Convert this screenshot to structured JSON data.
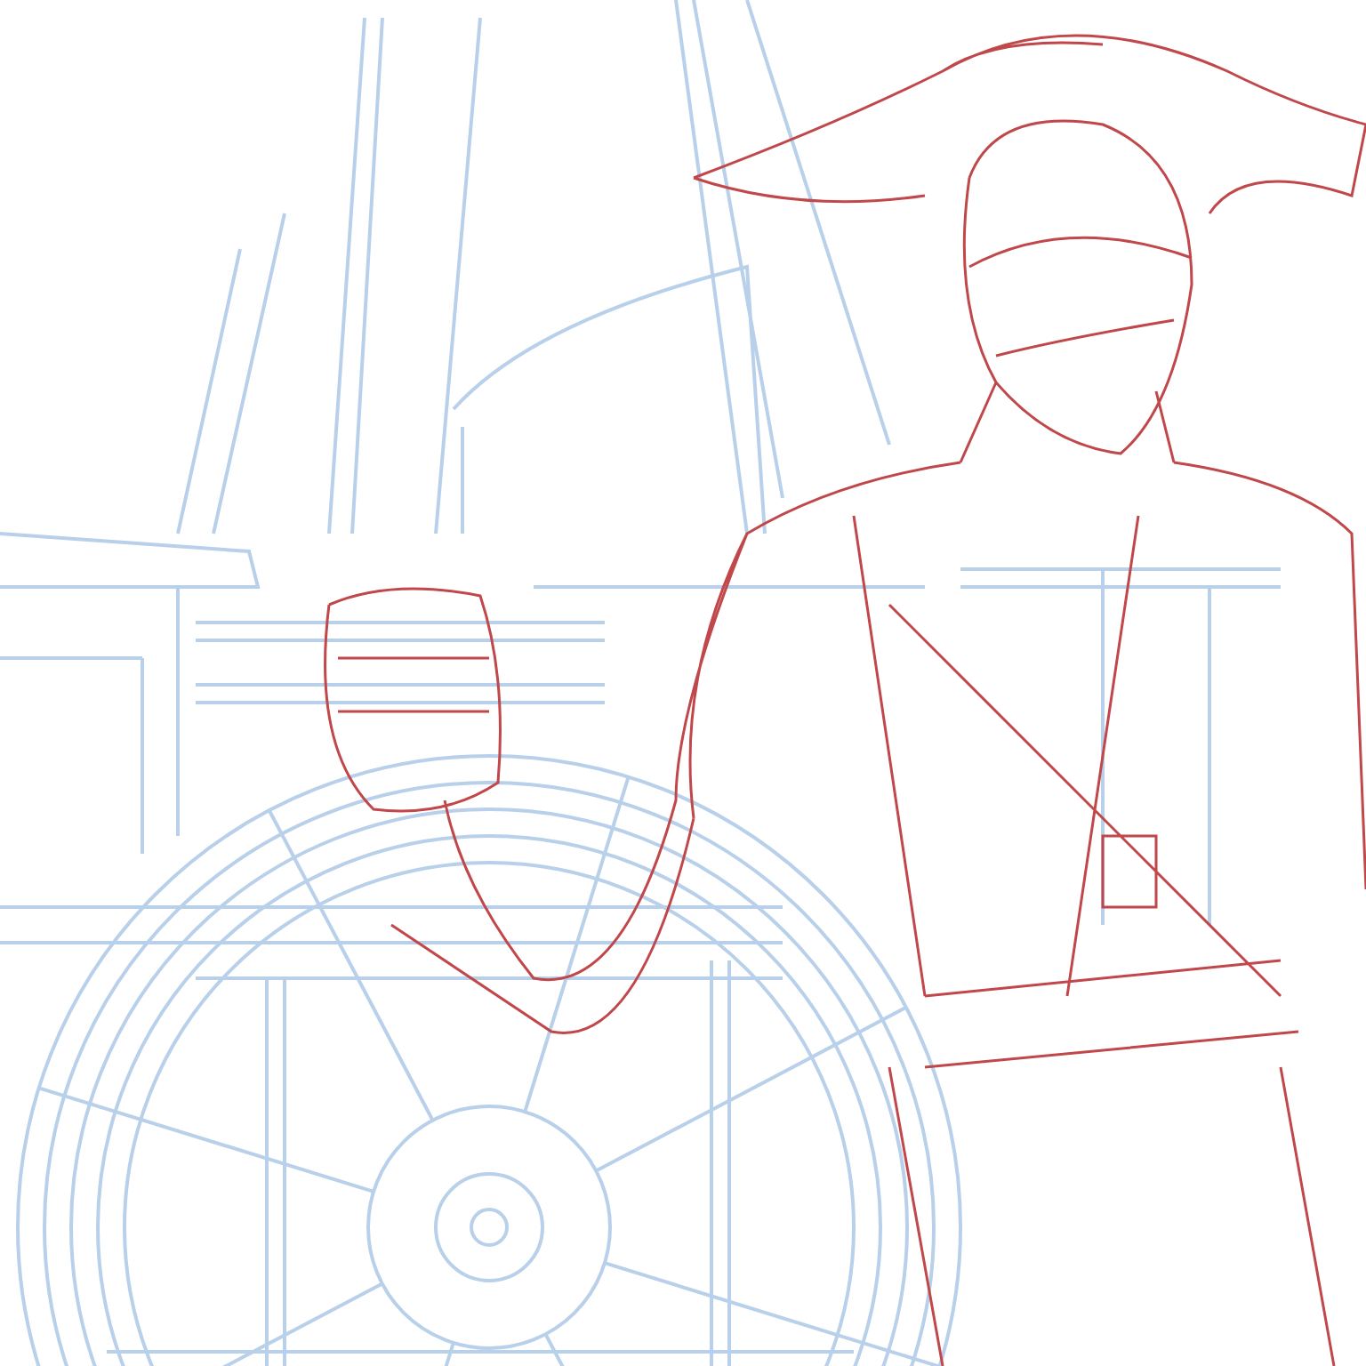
{
  "layers": [
    {
      "kind": "ship",
      "color": "#b9d0ea"
    },
    {
      "kind": "figure",
      "color": "#c0474a"
    }
  ]
}
